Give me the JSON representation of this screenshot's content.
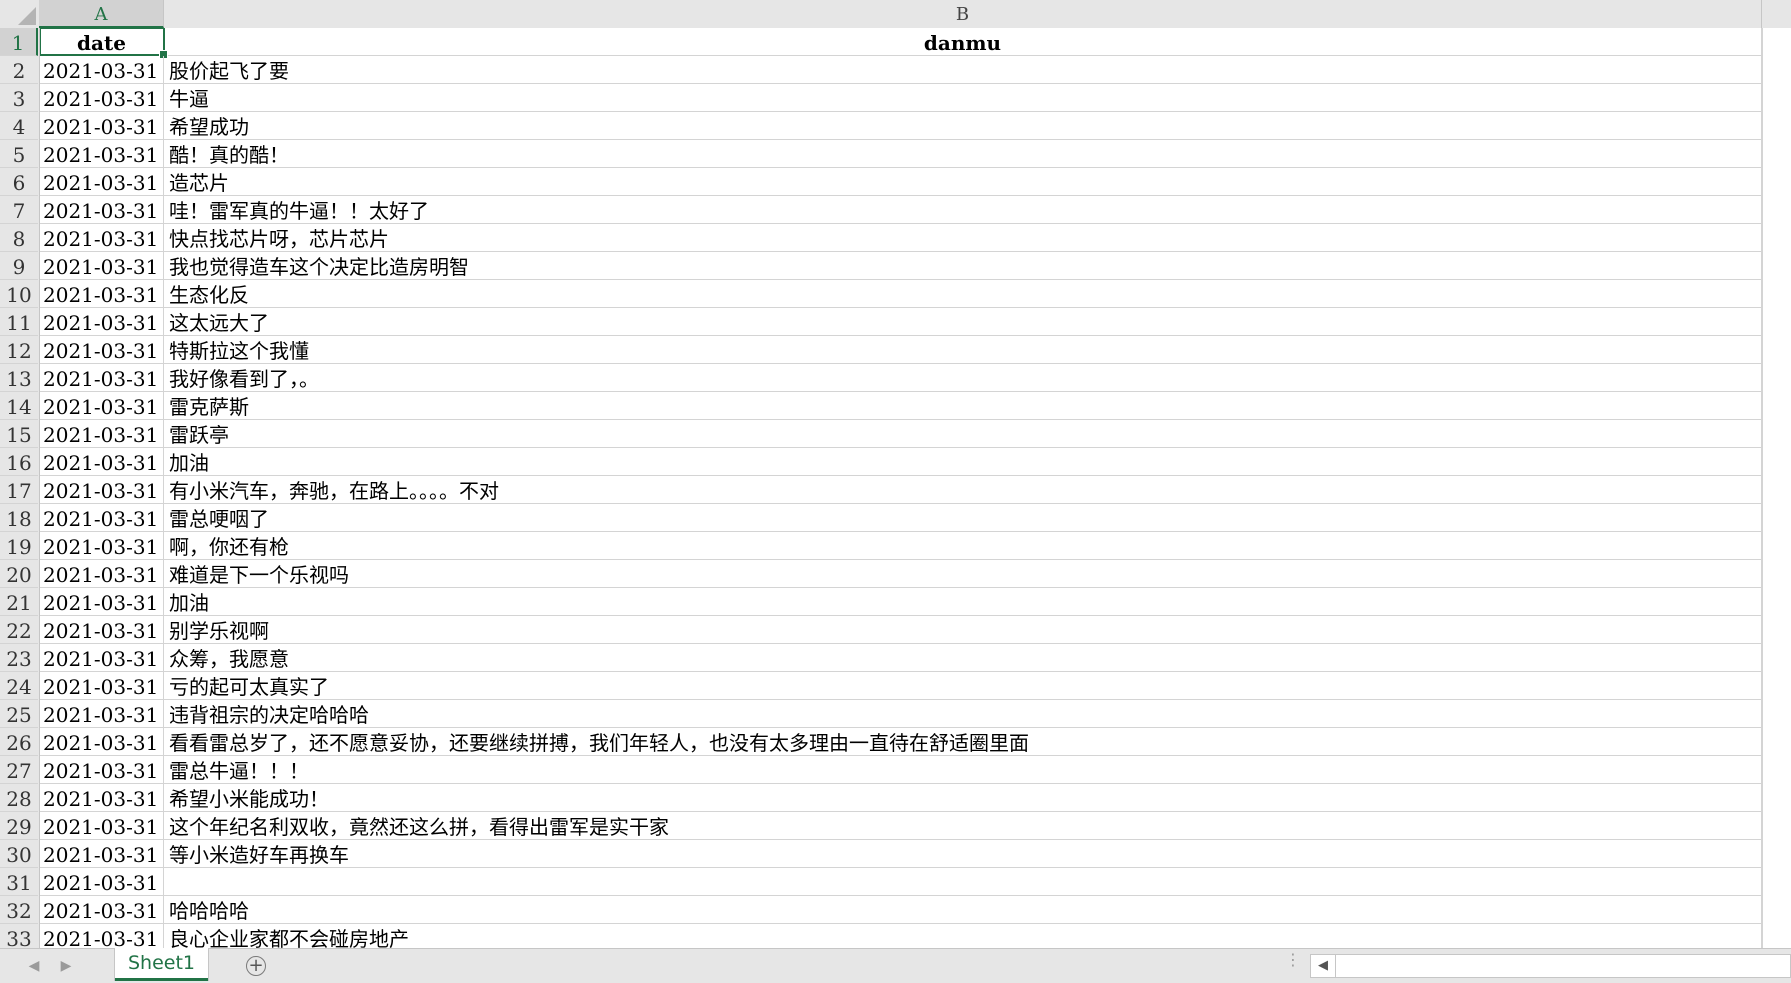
{
  "columns": [
    {
      "letter": "A"
    },
    {
      "letter": "B"
    }
  ],
  "header_row": {
    "row": "1",
    "a": "date",
    "b": "danmu"
  },
  "rows": [
    {
      "n": "2",
      "a": "2021-03-31",
      "b": "股价起飞了要"
    },
    {
      "n": "3",
      "a": "2021-03-31",
      "b": "牛逼"
    },
    {
      "n": "4",
      "a": "2021-03-31",
      "b": "希望成功"
    },
    {
      "n": "5",
      "a": "2021-03-31",
      "b": "酷！真的酷！"
    },
    {
      "n": "6",
      "a": "2021-03-31",
      "b": "造芯片"
    },
    {
      "n": "7",
      "a": "2021-03-31",
      "b": "哇！雷军真的牛逼！！太好了"
    },
    {
      "n": "8",
      "a": "2021-03-31",
      "b": "快点找芯片呀，芯片芯片"
    },
    {
      "n": "9",
      "a": "2021-03-31",
      "b": "我也觉得造车这个决定比造房明智"
    },
    {
      "n": "10",
      "a": "2021-03-31",
      "b": "生态化反"
    },
    {
      "n": "11",
      "a": "2021-03-31",
      "b": "这太远大了"
    },
    {
      "n": "12",
      "a": "2021-03-31",
      "b": "特斯拉这个我懂"
    },
    {
      "n": "13",
      "a": "2021-03-31",
      "b": "我好像看到了，。"
    },
    {
      "n": "14",
      "a": "2021-03-31",
      "b": "雷克萨斯"
    },
    {
      "n": "15",
      "a": "2021-03-31",
      "b": "雷跃亭"
    },
    {
      "n": "16",
      "a": "2021-03-31",
      "b": "加油"
    },
    {
      "n": "17",
      "a": "2021-03-31",
      "b": "有小米汽车，奔驰，在路上。。。。不对"
    },
    {
      "n": "18",
      "a": "2021-03-31",
      "b": "雷总哽咽了"
    },
    {
      "n": "19",
      "a": "2021-03-31",
      "b": "啊，你还有枪"
    },
    {
      "n": "20",
      "a": "2021-03-31",
      "b": "难道是下一个乐视吗"
    },
    {
      "n": "21",
      "a": "2021-03-31",
      "b": "加油"
    },
    {
      "n": "22",
      "a": "2021-03-31",
      "b": "别学乐视啊"
    },
    {
      "n": "23",
      "a": "2021-03-31",
      "b": "众筹，我愿意"
    },
    {
      "n": "24",
      "a": "2021-03-31",
      "b": "亏的起可太真实了"
    },
    {
      "n": "25",
      "a": "2021-03-31",
      "b": "违背祖宗的决定哈哈哈"
    },
    {
      "n": "26",
      "a": "2021-03-31",
      "b": "看看雷总岁了，还不愿意妥协，还要继续拼搏，我们年轻人，也没有太多理由一直待在舒适圈里面"
    },
    {
      "n": "27",
      "a": "2021-03-31",
      "b": "雷总牛逼！！！"
    },
    {
      "n": "28",
      "a": "2021-03-31",
      "b": "希望小米能成功！"
    },
    {
      "n": "29",
      "a": "2021-03-31",
      "b": "这个年纪名利双收，竟然还这么拼，看得出雷军是实干家"
    },
    {
      "n": "30",
      "a": "2021-03-31",
      "b": "等小米造好车再换车"
    },
    {
      "n": "31",
      "a": "2021-03-31",
      "b": ""
    },
    {
      "n": "32",
      "a": "2021-03-31",
      "b": "哈哈哈哈"
    },
    {
      "n": "33",
      "a": "2021-03-31",
      "b": "良心企业家都不会碰房地产"
    }
  ],
  "sheet_tab": {
    "label": "Sheet1"
  },
  "add_sheet": {
    "symbol": "+"
  },
  "icons": {
    "prev_sheet": "◀",
    "next_sheet": "▶",
    "scroll_left": "◀",
    "overflow": "⋮"
  },
  "colors": {
    "accent": "#217346",
    "header_bg": "#e6e6e6",
    "gridline": "#d4d4d4"
  }
}
